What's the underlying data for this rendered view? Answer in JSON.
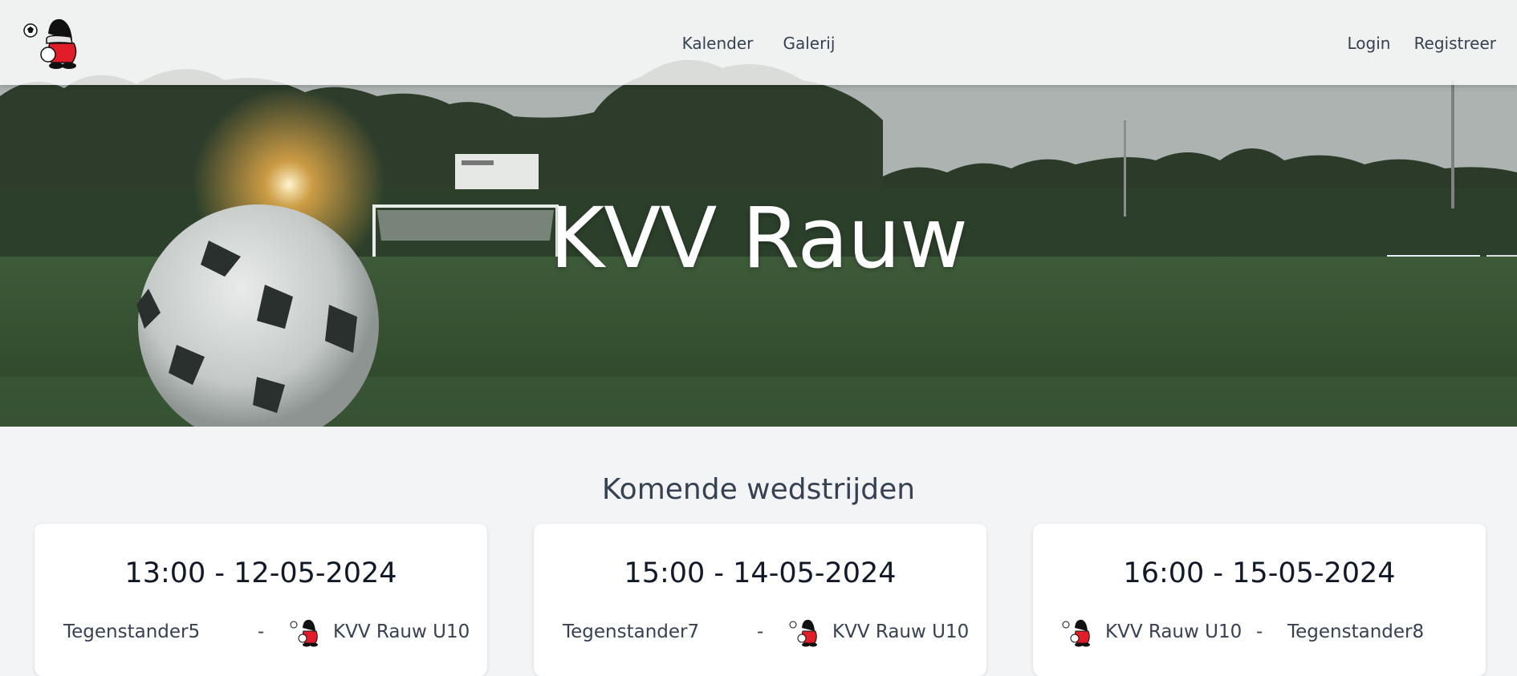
{
  "nav": {
    "links": [
      "Kalender",
      "Galerij"
    ],
    "auth": [
      "Login",
      "Registreer"
    ]
  },
  "hero": {
    "title": "KVV Rauw"
  },
  "section": {
    "title": "Komende wedstrijden"
  },
  "matches": [
    {
      "datetime": "13:00 - 12-05-2024",
      "home": "Tegenstander5",
      "separator": "-",
      "away": "KVV Rauw U10"
    },
    {
      "datetime": "15:00 - 14-05-2024",
      "home": "Tegenstander7",
      "separator": "-",
      "away": "KVV Rauw U10"
    },
    {
      "datetime": "16:00 - 15-05-2024",
      "home": "KVV Rauw U10",
      "separator": "-",
      "away": "Tegenstander8"
    }
  ],
  "colors": {
    "accent": "#e11d2a",
    "navbar_bg": "#ffffff",
    "page_bg": "#f3f4f6"
  },
  "icons": {
    "club_logo": "gnome-mascot-with-football-icon"
  }
}
